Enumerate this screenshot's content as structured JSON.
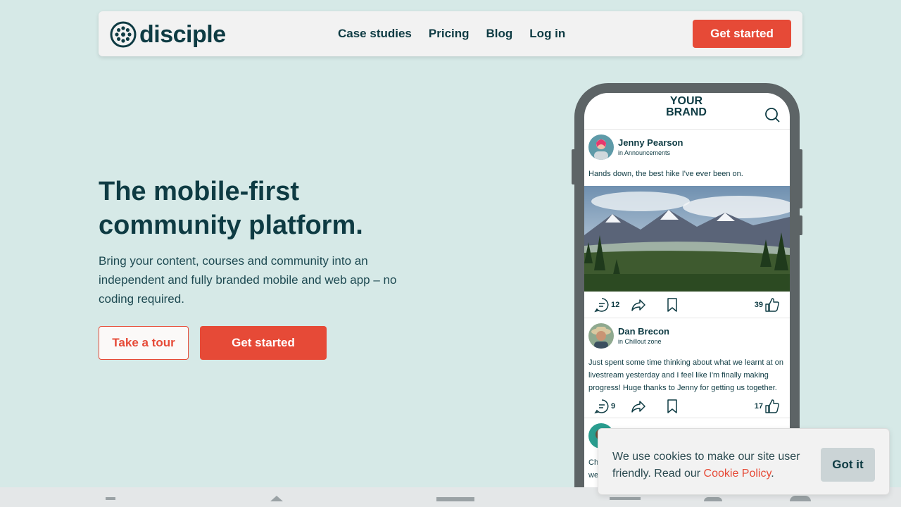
{
  "header": {
    "logo_text": "disciple",
    "nav": [
      "Case studies",
      "Pricing",
      "Blog",
      "Log in"
    ],
    "cta_label": "Get started"
  },
  "hero": {
    "title_line1": "The mobile-first",
    "title_line2": "community platform.",
    "subtitle": "Bring your content, courses and community into an independent and fully branded mobile and web app – no coding required.",
    "tour_label": "Take a tour",
    "cta_label": "Get started"
  },
  "phone": {
    "brand_line1": "YOUR",
    "brand_line2": "BRAND",
    "posts": [
      {
        "author": "Jenny Pearson",
        "channel": "in Announcements",
        "text": "Hands down, the best hike I've ever been on.",
        "comments": "12",
        "likes": "39"
      },
      {
        "author": "Dan Brecon",
        "channel": "in Chillout zone",
        "text": "Just spent some time thinking about what we learnt at on livestream yesterday and I feel like I'm finally making progress! Huge thanks to Jenny for getting us together.",
        "comments": "9",
        "likes": "17"
      }
    ],
    "partial_text_1": "Ch",
    "partial_text_2": "we"
  },
  "cookie": {
    "text": "We use cookies to make our site user friendly. Read our ",
    "link": "Cookie Policy",
    "after_link": ".",
    "button": "Got it"
  },
  "colors": {
    "background": "#d6e9e7",
    "primary": "#e64a37",
    "text": "#0e3b43"
  }
}
